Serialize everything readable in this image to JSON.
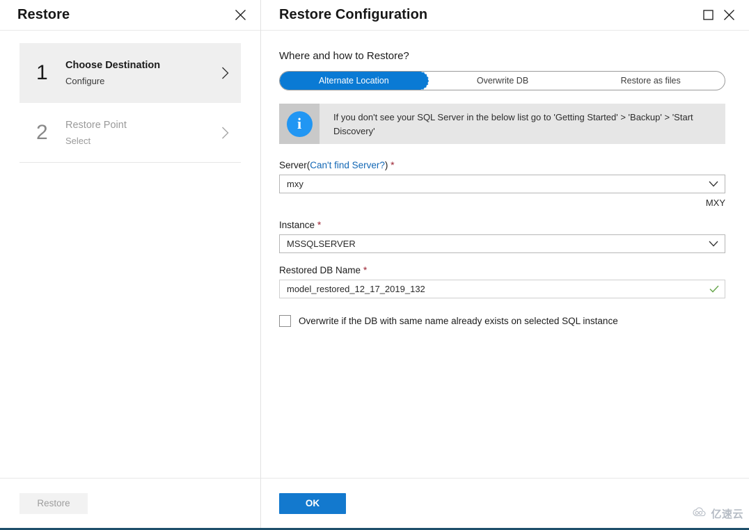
{
  "left_panel": {
    "title": "Restore",
    "close_icon": "close-icon",
    "steps": [
      {
        "number": "1",
        "title": "Choose Destination",
        "subtitle": "Configure",
        "chevron": "chevron-right-icon"
      },
      {
        "number": "2",
        "title": "Restore Point",
        "subtitle": "Select",
        "chevron": "chevron-right-icon"
      }
    ],
    "restore_button": "Restore"
  },
  "right_panel": {
    "title": "Restore Configuration",
    "maximize_icon": "maximize-icon",
    "close_icon": "close-icon",
    "section_heading": "Where and how to Restore?",
    "mode_toggle": {
      "options": [
        "Alternate Location",
        "Overwrite DB",
        "Restore as files"
      ],
      "selected": "Alternate Location"
    },
    "info_banner": {
      "icon": "info-icon",
      "text": "If you don't see your SQL Server in the below list go to 'Getting Started' > 'Backup' > 'Start Discovery'"
    },
    "server_field": {
      "label": "Server",
      "link_open": "(",
      "link_text": "Can't find Server?",
      "link_close": ")",
      "required_mark": "*",
      "value": "mxy",
      "dropdown_icon": "chevron-down-icon",
      "hint": "MXY"
    },
    "instance_field": {
      "label": "Instance",
      "required_mark": "*",
      "value": "MSSQLSERVER",
      "dropdown_icon": "chevron-down-icon"
    },
    "restored_db_field": {
      "label": "Restored DB Name",
      "required_mark": "*",
      "value": "model_restored_12_17_2019_132",
      "valid_icon": "checkmark-icon"
    },
    "overwrite_checkbox": {
      "label": "Overwrite if the DB with same name already exists on selected SQL instance",
      "checked": false
    },
    "ok_button": "OK"
  },
  "watermark": {
    "logo_icon": "cloud-logo-icon",
    "text": "亿速云"
  },
  "colors": {
    "accent_blue": "#0a7ad4",
    "ok_button_blue": "#1379ce",
    "link_blue": "#1267b5",
    "required_red": "#9b2231",
    "info_icon_blue": "#2196f3",
    "valid_green": "#6aa84f",
    "selected_step_bg": "#efefef",
    "banner_bg": "#e6e6e6",
    "bottom_border": "#1d4e6a"
  }
}
